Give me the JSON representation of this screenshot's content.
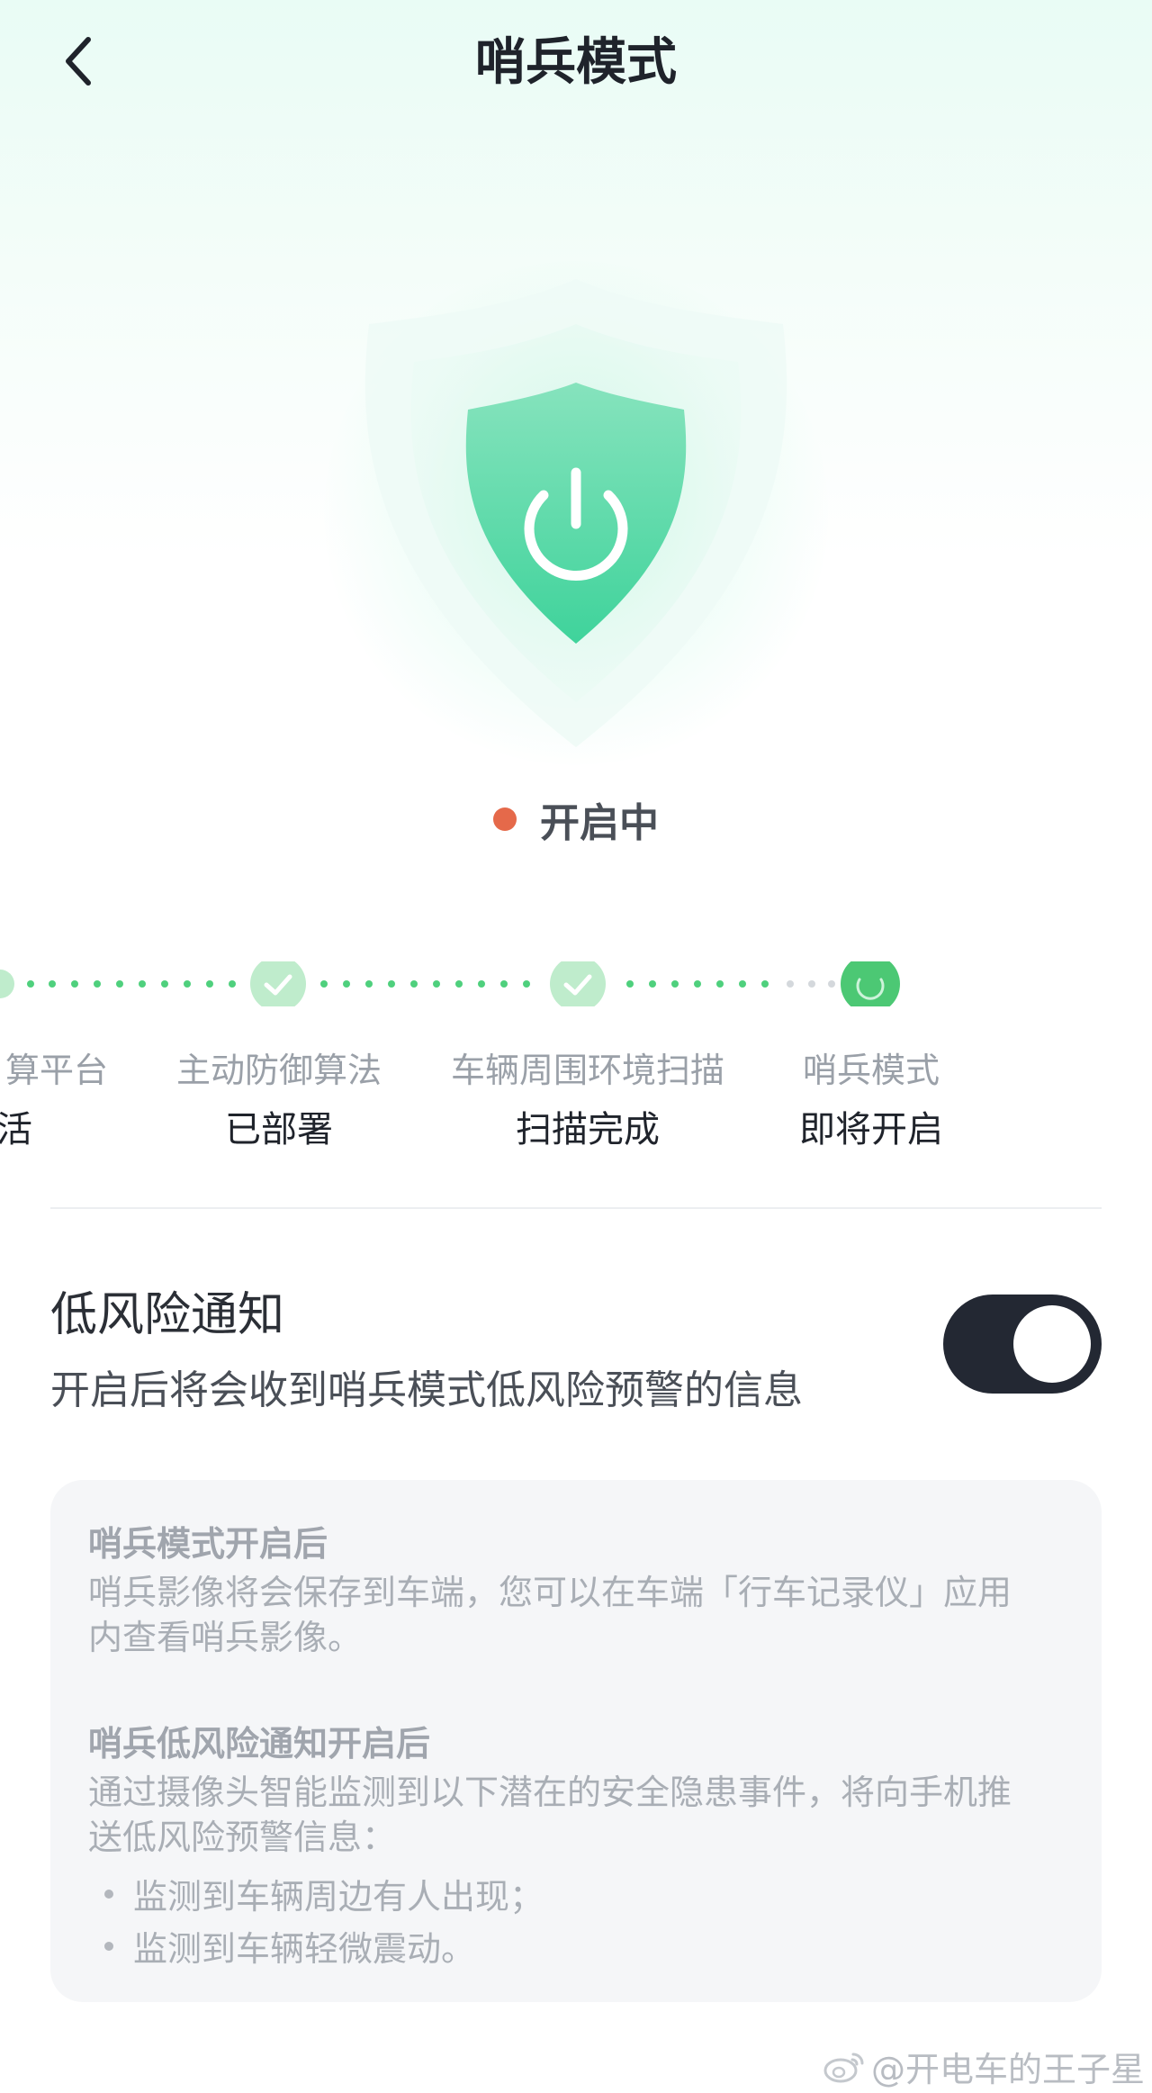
{
  "header": {
    "title": "哨兵模式",
    "back_icon": "chevron-left-icon"
  },
  "hero": {
    "icon": "shield-power-icon",
    "accent": "#3fd39b"
  },
  "status": {
    "text": "开启中",
    "dot_color": "#e5694a"
  },
  "steps": [
    {
      "label": "算平台",
      "value": "活",
      "state": "done"
    },
    {
      "label": "主动防御算法",
      "value": "已部署",
      "state": "done"
    },
    {
      "label": "车辆周围环境扫描",
      "value": "扫描完成",
      "state": "done"
    },
    {
      "label": "哨兵模式",
      "value": "即将开启",
      "state": "loading"
    }
  ],
  "notification": {
    "title": "低风险通知",
    "description": "开启后将会收到哨兵模式低风险预警的信息",
    "toggle_on": true
  },
  "info": {
    "h1": "哨兵模式开启后",
    "p1_line1": "哨兵影像将会保存到车端，您可以在车端「行车记录仪」应用",
    "p1_line2": "内查看哨兵影像。",
    "h2": "哨兵低风险通知开启后",
    "p2_line1": "通过摄像头智能监测到以下潜在的安全隐患事件，将向手机推",
    "p2_line2": "送低风险预警信息：",
    "bullets": [
      "监测到车辆周边有人出现；",
      "监测到车辆轻微震动。"
    ]
  },
  "watermark": {
    "text": "@开电车的王子星",
    "icon": "weibo-icon"
  }
}
